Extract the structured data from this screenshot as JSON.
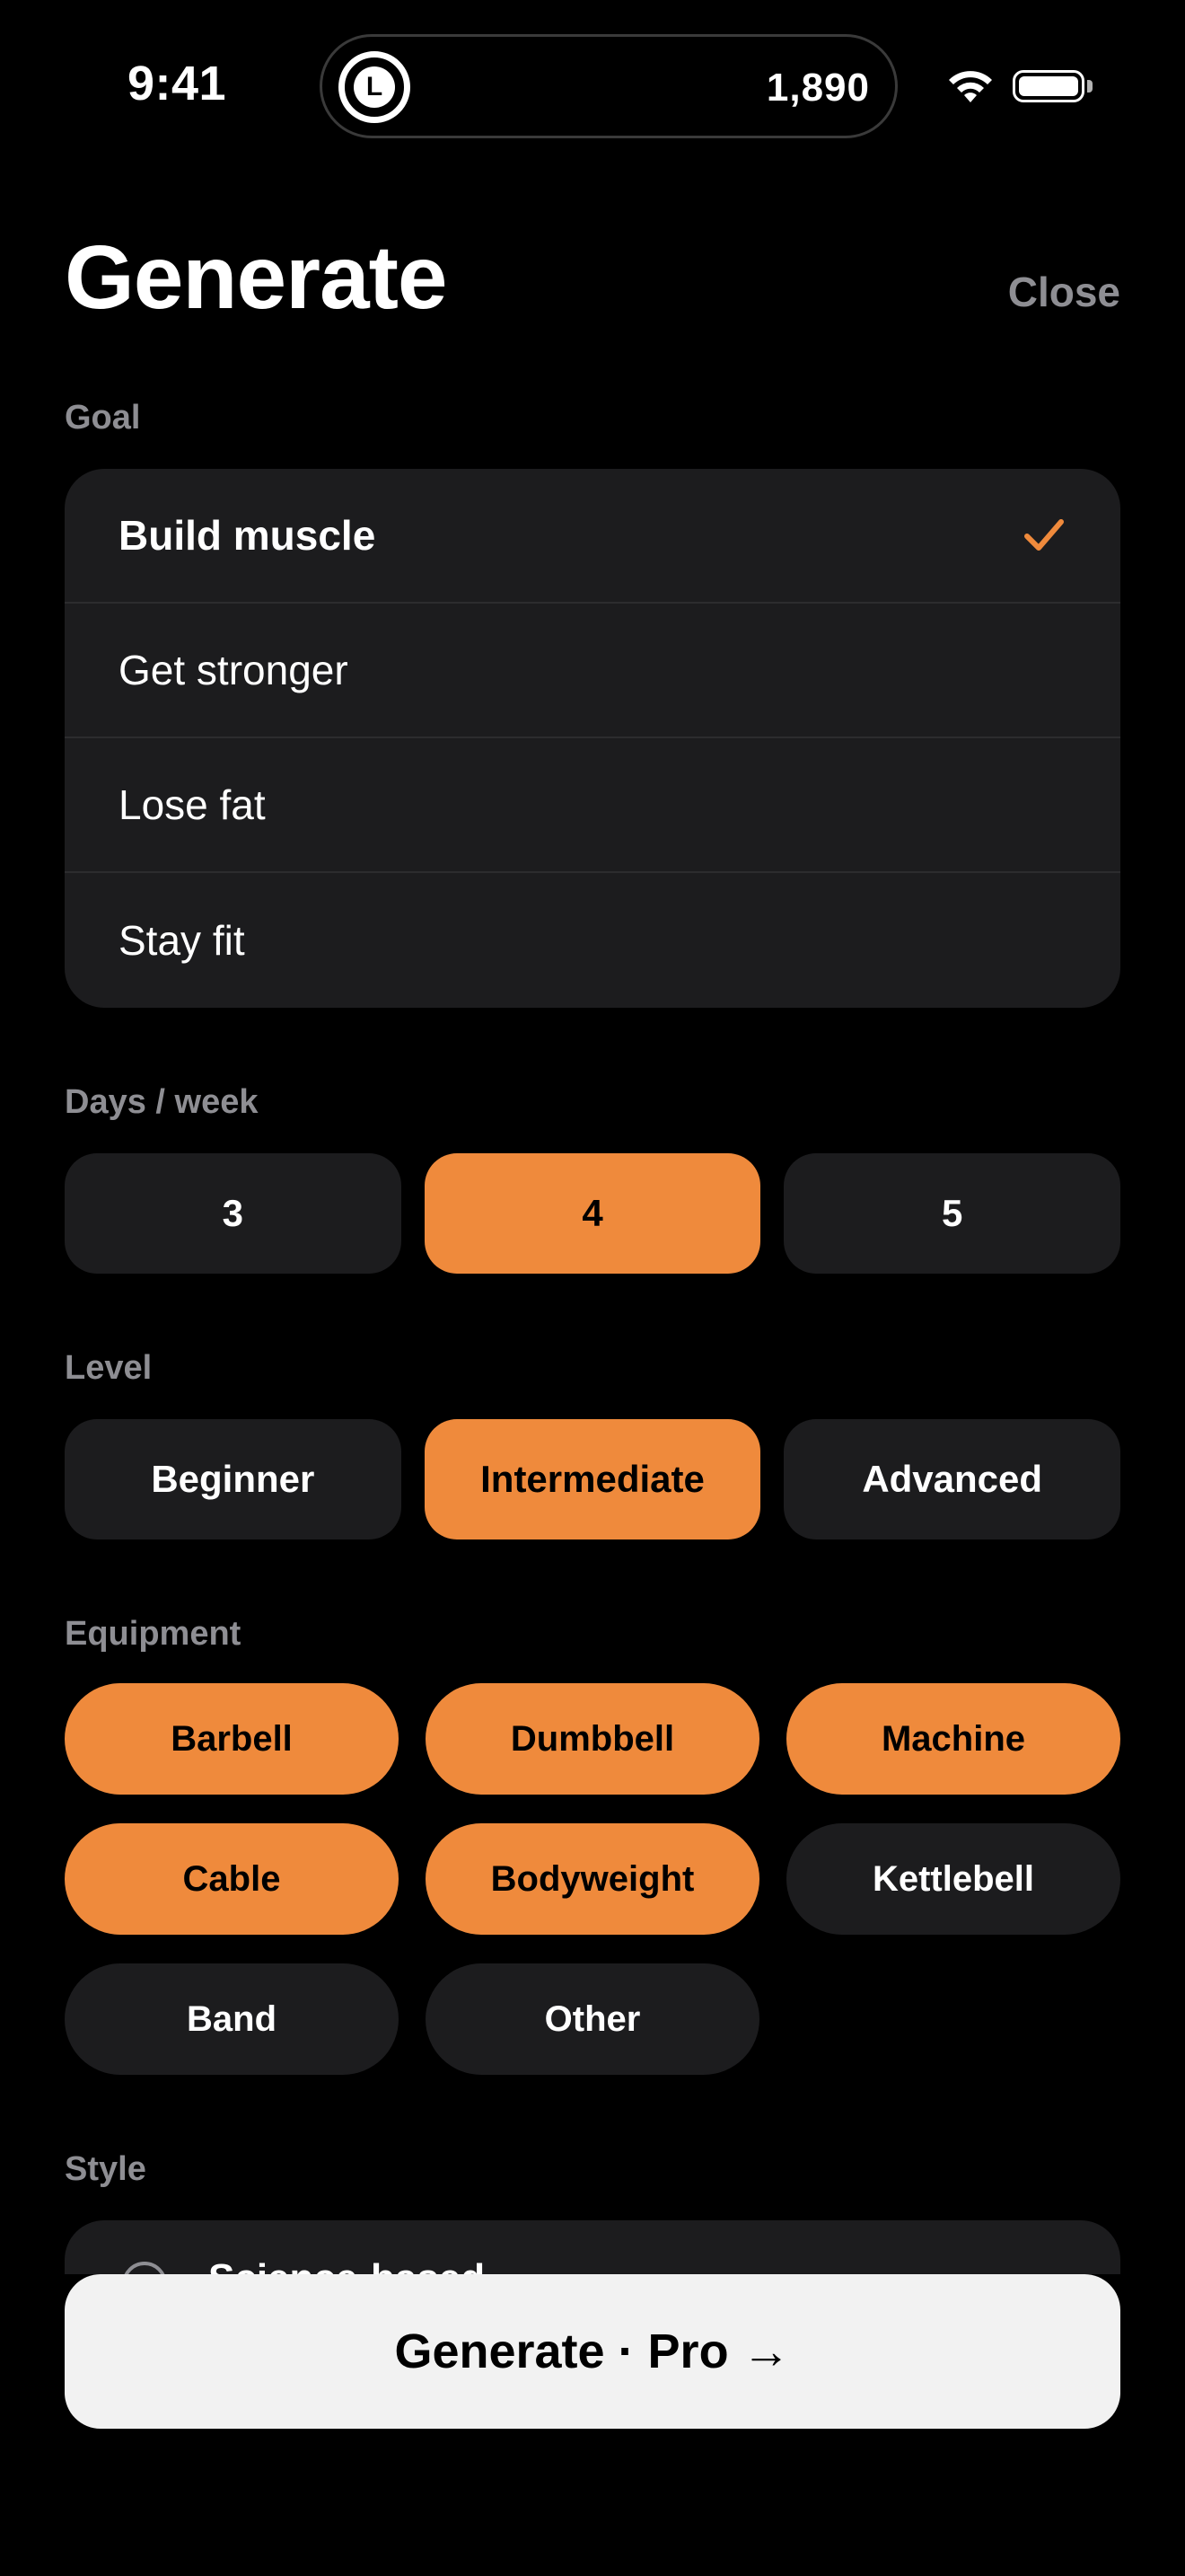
{
  "status": {
    "time": "9:41",
    "activity_icon_letter": "L",
    "activity_count": "1,890"
  },
  "header": {
    "title": "Generate",
    "close_label": "Close"
  },
  "goal": {
    "label": "Goal",
    "options": [
      {
        "label": "Build muscle",
        "selected": true
      },
      {
        "label": "Get stronger",
        "selected": false
      },
      {
        "label": "Lose fat",
        "selected": false
      },
      {
        "label": "Stay fit",
        "selected": false
      }
    ]
  },
  "days": {
    "label": "Days / week",
    "options": [
      "3",
      "4",
      "5"
    ],
    "selected": "4"
  },
  "level": {
    "label": "Level",
    "options": [
      "Beginner",
      "Intermediate",
      "Advanced"
    ],
    "selected": "Intermediate"
  },
  "equipment": {
    "label": "Equipment",
    "options": [
      {
        "label": "Barbell",
        "selected": true
      },
      {
        "label": "Dumbbell",
        "selected": true
      },
      {
        "label": "Machine",
        "selected": true
      },
      {
        "label": "Cable",
        "selected": true
      },
      {
        "label": "Bodyweight",
        "selected": true
      },
      {
        "label": "Kettlebell",
        "selected": false
      },
      {
        "label": "Band",
        "selected": false
      },
      {
        "label": "Other",
        "selected": false
      }
    ]
  },
  "style": {
    "label": "Style",
    "first_option": "Science-based"
  },
  "generate_button": {
    "label": "Generate · Pro →"
  },
  "colors": {
    "accent": "#ef8a3c",
    "card": "#1c1c1e",
    "muted": "#8e8e93",
    "background": "#000000"
  }
}
